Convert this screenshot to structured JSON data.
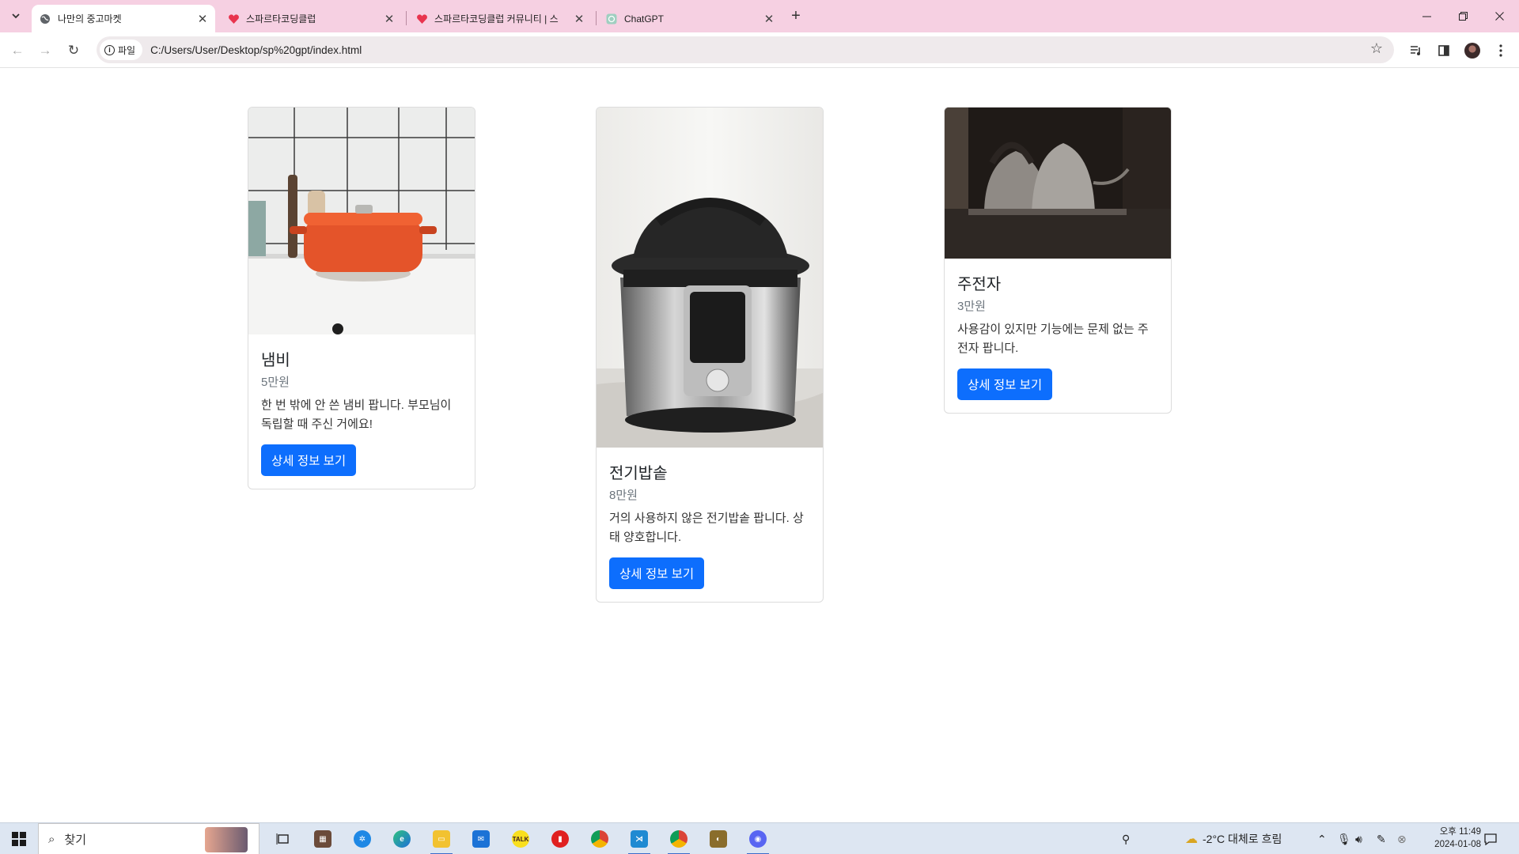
{
  "browser": {
    "tabs": [
      {
        "title": "나만의 중고마켓",
        "active": true,
        "icon": "globe-icon"
      },
      {
        "title": "스파르타코딩클럽",
        "active": false,
        "icon": "sparta-heart-icon"
      },
      {
        "title": "스파르타코딩클럽 커뮤니티 | 스",
        "active": false,
        "icon": "sparta-heart-icon"
      },
      {
        "title": "ChatGPT",
        "active": false,
        "icon": "chatgpt-icon"
      }
    ],
    "chip_label": "파일",
    "url": "C:/Users/User/Desktop/sp%20gpt/index.html",
    "colors": {
      "tabbar": "#f6d0e2",
      "omnibox": "#efeaec"
    }
  },
  "products": [
    {
      "title": "냄비",
      "price": "5만원",
      "description": "한 번 밖에 안 쓴 냄비 팝니다. 부모님이 독립할 때 주신 거에요!",
      "button": "상세 정보 보기",
      "image": "orange-pot-photo"
    },
    {
      "title": "전기밥솥",
      "price": "8만원",
      "description": "거의 사용하지 않은 전기밥솥 팝니다. 상태 양호합니다.",
      "button": "상세 정보 보기",
      "image": "pressure-cooker-photo"
    },
    {
      "title": "주전자",
      "price": "3만원",
      "description": "사용감이 있지만 기능에는 문제 없는 주전자 팝니다.",
      "button": "상세 정보 보기",
      "image": "kettle-photo"
    }
  ],
  "accent": "#0d6efd",
  "taskbar": {
    "search_placeholder": "찾기",
    "weather": "-2°C  대체로 흐림",
    "time": "오후 11:49",
    "date": "2024-01-08"
  }
}
